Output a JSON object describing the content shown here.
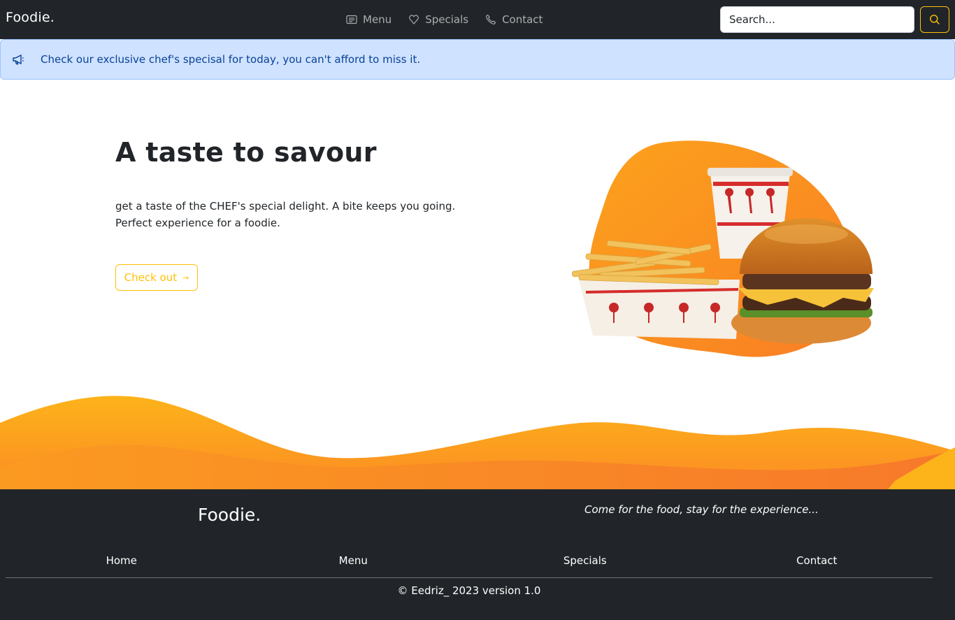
{
  "navbar": {
    "brand": "Foodie.",
    "links": [
      {
        "label": "Menu",
        "icon": "menu-list-icon"
      },
      {
        "label": "Specials",
        "icon": "heart-icon"
      },
      {
        "label": "Contact",
        "icon": "phone-icon"
      }
    ],
    "search_placeholder": "Search...",
    "search_button_icon": "search-icon"
  },
  "alert": {
    "icon": "megaphone-icon",
    "text": "Check our exclusive chef's specisal for today, you can't afford to miss it."
  },
  "hero": {
    "title": "A taste to savour",
    "text": "get a taste of the CHEF's special delight. A bite keeps you going. Perfect experience for a foodie.",
    "button_label": "Check out",
    "button_icon": "arrow-right-icon",
    "image": "burger-fries-drink-image"
  },
  "footer": {
    "brand": "Foodie.",
    "tagline": "Come for the food, stay for the experience...",
    "nav": [
      "Home",
      "Menu",
      "Specials",
      "Contact"
    ],
    "copyright": "© Eedriz_ 2023 version 1.0"
  },
  "colors": {
    "navbar_bg": "#212529",
    "accent": "#ffc107",
    "alert_bg": "#cfe2ff",
    "alert_text": "#084298",
    "wave_orange": "#fb8c24",
    "wave_yellow": "#fdb31a"
  }
}
